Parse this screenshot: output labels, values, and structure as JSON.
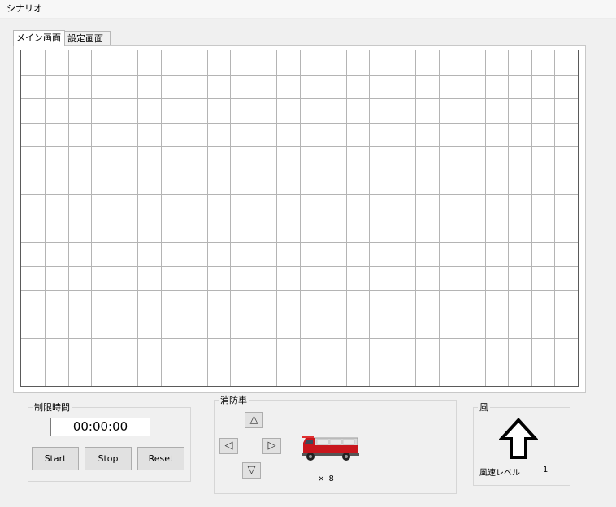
{
  "menu": {
    "scenario": "シナリオ"
  },
  "tabs": [
    {
      "label": "メイン画面",
      "selected": true
    },
    {
      "label": "設定画面",
      "selected": false
    }
  ],
  "grid": {
    "columns": 24,
    "rows": 14,
    "line_color": "#b4b4b4"
  },
  "time_limit": {
    "title": "制限時間",
    "display": "00:00:00",
    "start_label": "Start",
    "stop_label": "Stop",
    "reset_label": "Reset"
  },
  "fire_truck": {
    "title": "消防車",
    "up": "△",
    "left": "◁",
    "right": "▷",
    "down": "▽",
    "icon": "fire-truck-icon",
    "count_text": "× 8"
  },
  "wind": {
    "title": "風",
    "icon": "up-arrow-icon",
    "level_label": "風速レベル",
    "level_value": "1"
  }
}
